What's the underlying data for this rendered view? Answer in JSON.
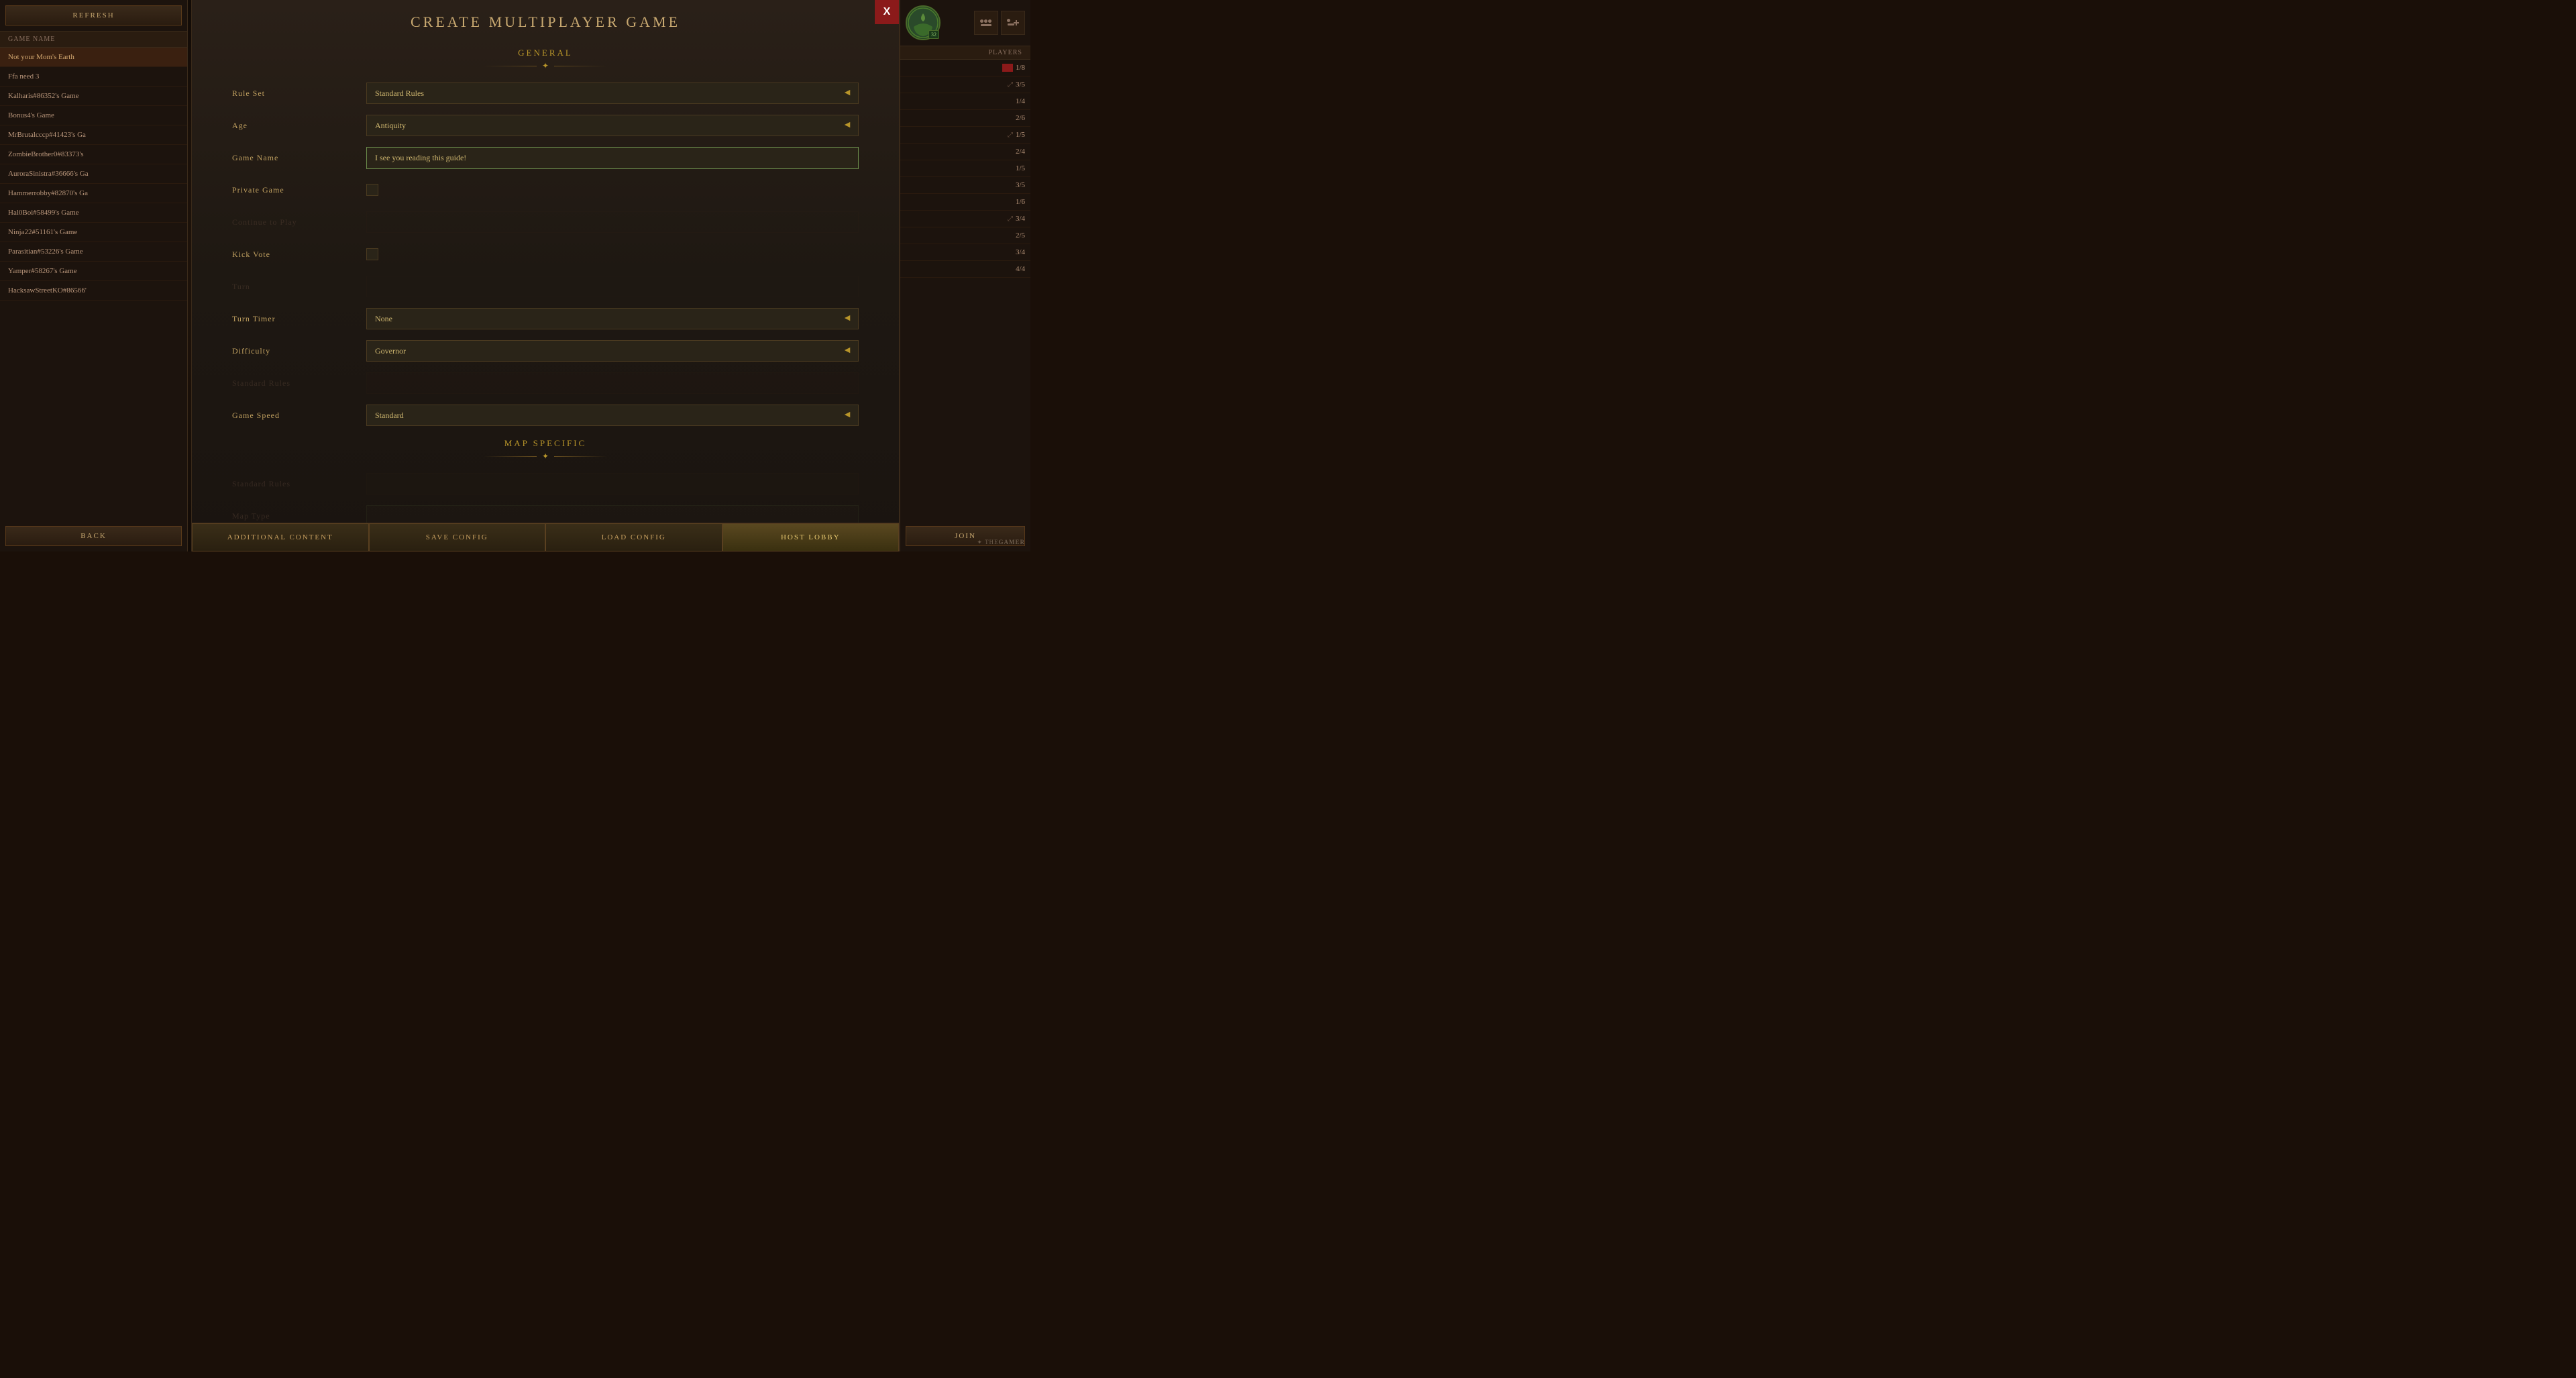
{
  "sidebar": {
    "refresh_label": "REFRESH",
    "header_label": "GAME NAME",
    "back_label": "BACK",
    "items": [
      {
        "name": "Not your Mom's Earth",
        "selected": true
      },
      {
        "name": "Ffa need 3",
        "selected": false
      },
      {
        "name": "Kalharis#86352's Game",
        "selected": false
      },
      {
        "name": "Bonus4's Game",
        "selected": false
      },
      {
        "name": "MrBrutalcccp#41423's Ga",
        "selected": false
      },
      {
        "name": "ZombieBrother0#83373's",
        "selected": false
      },
      {
        "name": "AuroraSinistra#36666's Ga",
        "selected": false
      },
      {
        "name": "Hammerrobby#82870's Ga",
        "selected": false
      },
      {
        "name": "Hal0Boi#58499's Game",
        "selected": false
      },
      {
        "name": "Ninja22#51161's Game",
        "selected": false
      },
      {
        "name": "Parasitian#53226's Game",
        "selected": false
      },
      {
        "name": "Yamper#58267's Game",
        "selected": false
      },
      {
        "name": "HacksawStreetKO#86566'",
        "selected": false
      }
    ]
  },
  "modal": {
    "title": "CREATE MULTIPLAYER GAME",
    "close_label": "X",
    "sections": {
      "general": {
        "title": "GENERAL",
        "fields": {
          "rule_set": {
            "label": "Rule Set",
            "value": "Standard Rules"
          },
          "age": {
            "label": "Age",
            "value": "Antiquity"
          },
          "game_name": {
            "label": "Game Name",
            "value": "I see you reading this guide!"
          },
          "private_game": {
            "label": "Private Game",
            "checked": false
          },
          "kick_vote": {
            "label": "Kick Vote",
            "checked": false
          },
          "turn_timer": {
            "label": "Turn Timer",
            "value": "None"
          },
          "difficulty": {
            "label": "Difficulty",
            "value": "Governor"
          },
          "game_speed": {
            "label": "Game Speed",
            "value": "Standard"
          }
        }
      },
      "map_specific": {
        "title": "MAP SPECIFIC"
      }
    },
    "footer": {
      "additional_content": "ADDITIONAL CONTENT",
      "save_config": "SAVE CONFIG",
      "load_config": "LOAD CONFIG",
      "host_lobby": "HOST LOBBY"
    }
  },
  "right_panel": {
    "players_label": "PLAYERS",
    "join_label": "JOIN",
    "level": "32",
    "rows": [
      {
        "count": "1/8",
        "flag": true
      },
      {
        "expand": true,
        "count": "3/5"
      },
      {
        "count": "1/4"
      },
      {
        "count": "2/6"
      },
      {
        "expand": true,
        "count": "1/5"
      },
      {
        "count": "2/4"
      },
      {
        "count": "1/5"
      },
      {
        "count": "3/5"
      },
      {
        "count": "1/6"
      },
      {
        "expand": true,
        "count": "3/4"
      },
      {
        "count": "2/5"
      },
      {
        "count": "3/4"
      },
      {
        "count": "4/4"
      }
    ]
  },
  "watermark": "THEGAMER"
}
